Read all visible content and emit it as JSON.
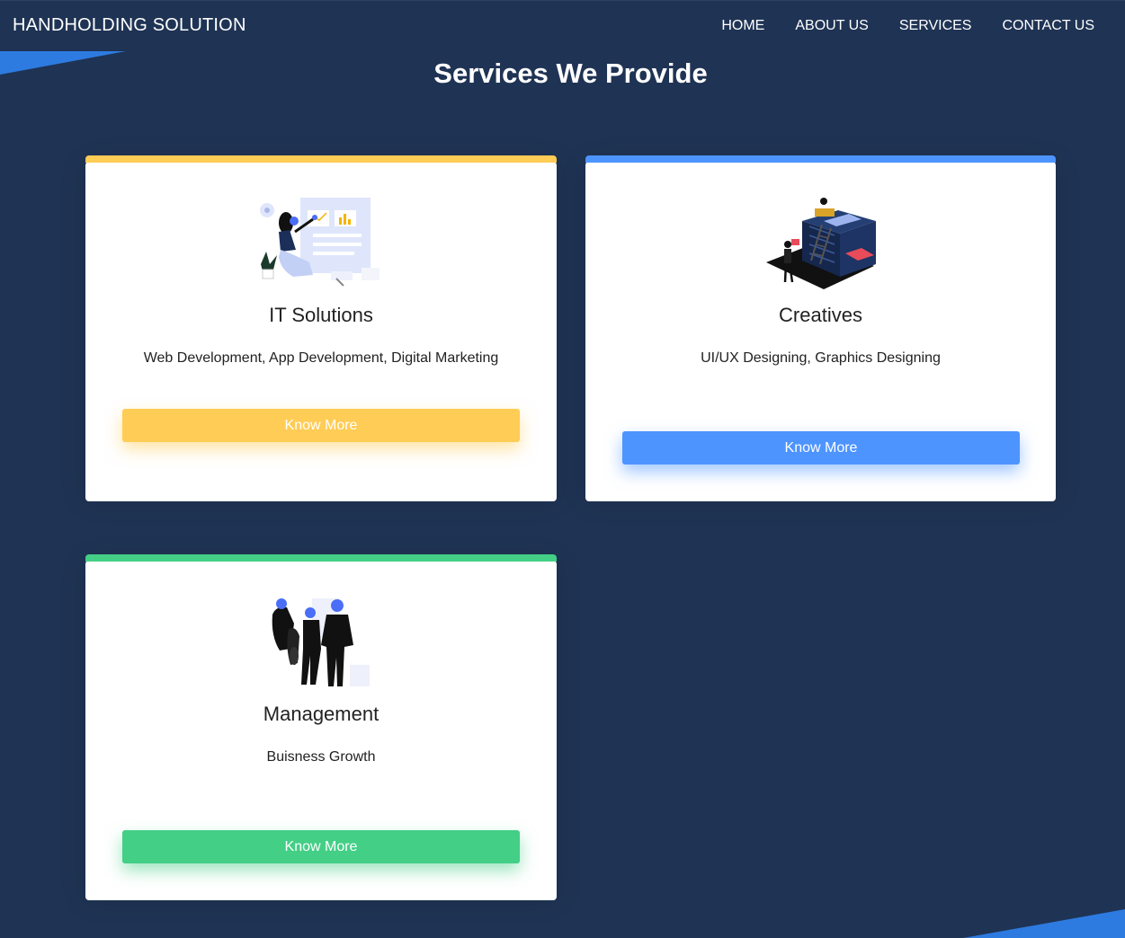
{
  "brand": "HANDHOLDING SOLUTION",
  "nav": [
    "HOME",
    "ABOUT US",
    "SERVICES",
    "CONTACT US"
  ],
  "section_title": "Services We Provide",
  "colors": {
    "background": "#1f3354",
    "accent_blue": "#2d7be0",
    "yellow": "#ffcc55",
    "blue": "#4d94ff",
    "green": "#43cf86"
  },
  "cards": [
    {
      "title": "IT Solutions",
      "description": "Web Development, App Development, Digital Marketing",
      "button": "Know More",
      "color": "#ffcc55",
      "illustration": "woman-with-dashboard-illustration"
    },
    {
      "title": "Creatives",
      "description": "UI/UX Designing, Graphics Designing",
      "button": "Know More",
      "color": "#4d94ff",
      "illustration": "isometric-building-illustration"
    },
    {
      "title": "Management",
      "description": "Buisness Growth",
      "button": "Know More",
      "color": "#43cf86",
      "illustration": "team-group-illustration"
    }
  ]
}
